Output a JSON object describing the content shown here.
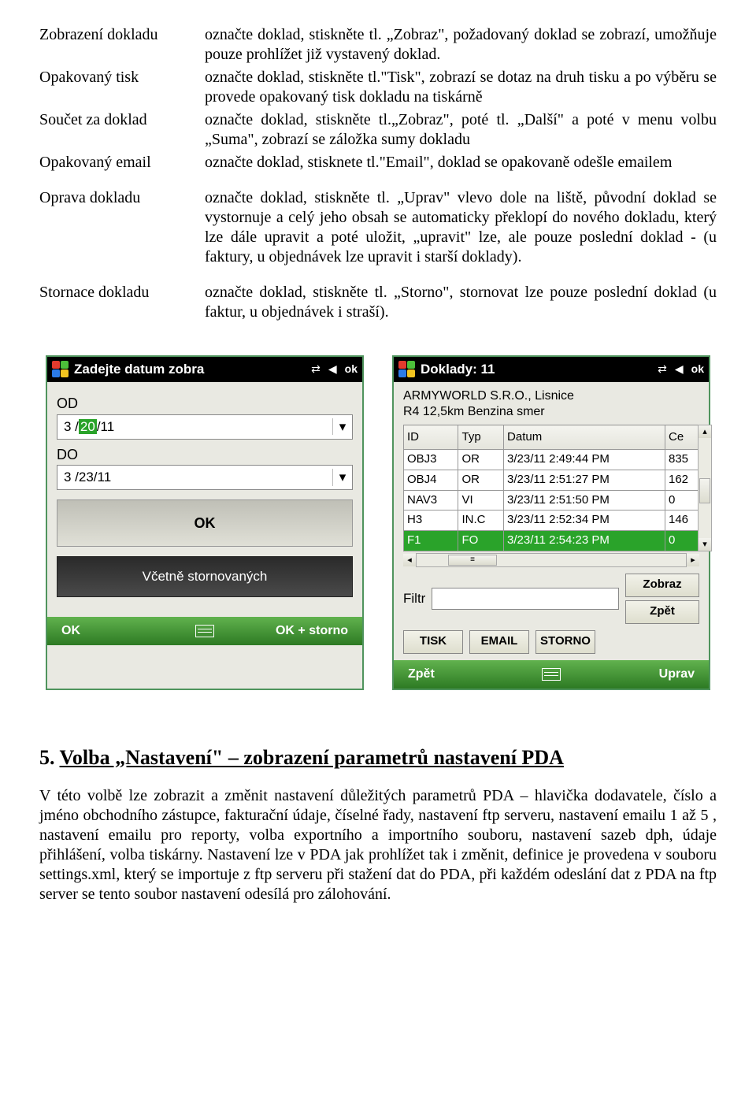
{
  "defs": [
    {
      "term": "Zobrazení dokladu",
      "desc": "označte doklad, stiskněte tl. „Zobraz\", požadovaný doklad se zobrazí, umožňuje pouze prohlížet již vystavený doklad."
    },
    {
      "term": "Opakovaný tisk",
      "desc": "označte doklad, stiskněte tl.\"Tisk\", zobrazí se dotaz na druh tisku a po výběru se provede opakovaný tisk dokladu na tiskárně"
    },
    {
      "term": "Součet za doklad",
      "desc": "označte doklad, stiskněte tl.„Zobraz\", poté tl. „Další\" a poté v menu volbu „Suma\", zobrazí se záložka sumy dokladu"
    },
    {
      "term": "Opakovaný email",
      "desc": "označte doklad, stisknete tl.\"Email\", doklad se opakovaně odešle emailem"
    },
    {
      "term": "Oprava dokladu",
      "desc": "označte doklad, stiskněte tl. „Uprav\" vlevo dole na liště,   původní doklad se vystornuje a celý jeho obsah se automaticky překlopí do nového dokladu, který lze dále upravit a poté uložit, „upravit\" lze, ale pouze poslední doklad - (u faktury, u objednávek lze upravit i starší doklady)."
    },
    {
      "term": "Stornace dokladu",
      "desc": "označte doklad, stiskněte tl. „Storno\", stornovat lze pouze poslední doklad (u faktur, u objednávek i straší)."
    }
  ],
  "pda1": {
    "title": "Zadejte datum zobra",
    "status_ok": "ok",
    "od": "OD",
    "od_date_prefix": "3 /",
    "od_date_sel": "20",
    "od_date_suffix": "/11",
    "do": "DO",
    "do_date": "3 /23/11",
    "ok_btn": "OK",
    "storno_btn": "Včetně stornovaných",
    "bottom_left": "OK",
    "bottom_right": "OK + storno"
  },
  "pda2": {
    "title": "Doklady: 11",
    "status_ok": "ok",
    "customer": "ARMYWORLD S.R.O., Lisnice",
    "address": "R4 12,5km  Benzina   smer",
    "cols": [
      "ID",
      "Typ",
      "Datum",
      "Ce"
    ],
    "rows": [
      {
        "id": "OBJ3",
        "typ": "OR",
        "datum": "3/23/11 2:49:44 PM",
        "ce": "835"
      },
      {
        "id": "OBJ4",
        "typ": "OR",
        "datum": "3/23/11 2:51:27 PM",
        "ce": "162"
      },
      {
        "id": "NAV3",
        "typ": "VI",
        "datum": "3/23/11 2:51:50 PM",
        "ce": "0"
      },
      {
        "id": "H3",
        "typ": "IN.C",
        "datum": "3/23/11 2:52:34 PM",
        "ce": "146"
      },
      {
        "id": "F1",
        "typ": "FO",
        "datum": "3/23/11 2:54:23 PM",
        "ce": "0",
        "selected": true
      }
    ],
    "filtr": "Filtr",
    "btn_zobraz": "Zobraz",
    "btn_zpet": "Zpět",
    "btn_tisk": "TISK",
    "btn_email": "EMAIL",
    "btn_storno": "STORNO",
    "bottom_left": "Zpět",
    "bottom_right": "Uprav"
  },
  "section": {
    "num": "5.",
    "title": "Volba „Nastavení\" – zobrazení parametrů nastavení PDA",
    "para": "V této volbě lze zobrazit a změnit nastavení důležitých parametrů PDA – hlavička dodavatele, číslo a jméno obchodního zástupce, fakturační údaje, číselné řady, nastavení ftp serveru, nastavení emailu 1 až 5 , nastavení emailu pro reporty, volba exportního a importního souboru, nastavení sazeb dph, údaje přihlášení, volba tiskárny. Nastavení lze v PDA jak prohlížet tak i změnit, definice je provedena v souboru settings.xml, který se importuje z ftp serveru při stažení dat do PDA, při každém odeslání dat z PDA na ftp server se tento soubor nastavení odesílá pro zálohování."
  }
}
